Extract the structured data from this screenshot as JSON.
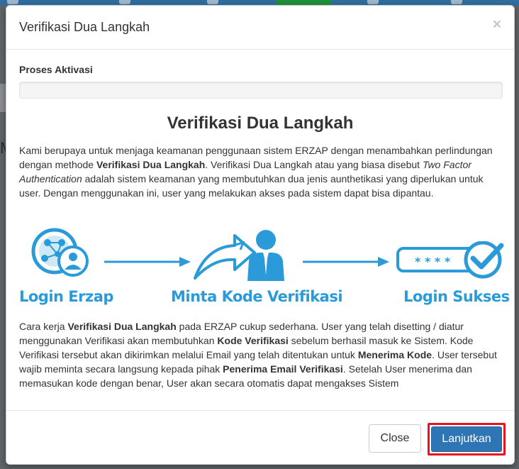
{
  "modal": {
    "title": "Verifikasi Dua Langkah",
    "close_glyph": "×",
    "progress_label": "Proses Aktivasi",
    "progress_fraction": 0,
    "heading": "Verifikasi Dua Langkah",
    "para1": {
      "t1": "Kami berupaya untuk menjaga keamanan penggunaan sistem ERZAP dengan menambahkan perlindungan dengan methode ",
      "b1": "Verifikasi Dua Langkah",
      "t2": ". Verifikasi Dua Langkah atau yang biasa disebut ",
      "i1": "Two Factor Authentication",
      "t3": " adalah sistem keamanan yang membutuhkan dua jenis aunthetikasi yang diperlukan untuk user. Dengan menggunakan ini, user yang melakukan akses pada sistem dapat bisa dipantau."
    },
    "steps": [
      {
        "label": "Login Erzap",
        "icon": "login-network-user-icon"
      },
      {
        "label": "Minta Kode Verifikasi",
        "icon": "forward-arrow-user-icon"
      },
      {
        "label": "Login Sukses",
        "icon": "password-checkmark-icon"
      }
    ],
    "password_mask": "* * * *",
    "para2": {
      "t1": "Cara kerja ",
      "b1": "Verifikasi Dua Langkah",
      "t2": " pada ERZAP cukup sederhana. User yang telah disetting / diatur menggunakan Verifikasi akan membutuhkan ",
      "b2": "Kode Verifikasi",
      "t3": " sebelum berhasil masuk ke Sistem. Kode Verifikasi tersebut akan dikirimkan melalui Email yang telah ditentukan untuk ",
      "b3": "Menerima Kode",
      "t4": ". User tersebut wajib meminta secara langsung kepada pihak ",
      "b4": "Penerima Email Verifikasi",
      "t5": ". Setelah User menerima dan memasukan kode dengan benar, User akan secara otomatis dapat mengakses Sistem"
    },
    "buttons": {
      "close": "Close",
      "next": "Lanjutkan"
    }
  },
  "colors": {
    "accent_blue": "#2e75b6",
    "illustration_blue": "#2a9bd8",
    "highlight_red": "#e8141b"
  }
}
